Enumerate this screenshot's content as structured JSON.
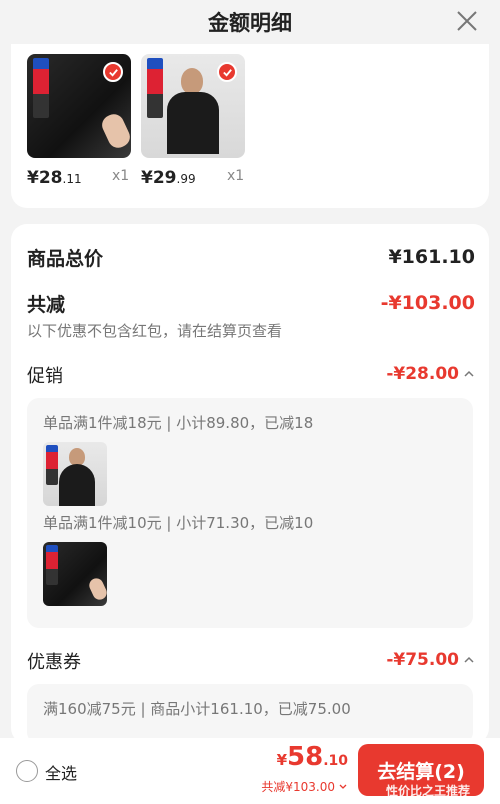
{
  "header": {
    "title": "金额明细"
  },
  "items": [
    {
      "price_main": "¥28",
      "price_dec": ".11",
      "qty": "x1"
    },
    {
      "price_main": "¥29",
      "price_dec": ".99",
      "qty": "x1"
    }
  ],
  "summary": {
    "total_label": "商品总价",
    "total_value": "¥161.10",
    "discount_label": "共减",
    "discount_value": "-¥103.00",
    "hint": "以下优惠不包含红包，请在结算页查看"
  },
  "promotion": {
    "label": "促销",
    "value": "-¥28.00",
    "rules": [
      {
        "text": "单品满1件减18元 | 小计89.80，已减18"
      },
      {
        "text": "单品满1件减10元 | 小计71.30，已减10"
      }
    ]
  },
  "coupon": {
    "label": "优惠券",
    "value": "-¥75.00",
    "rule_text": "满160减75元 | 商品小计161.10，已减75.00"
  },
  "footer": {
    "select_all": "全选",
    "currency": "¥",
    "amount": "58",
    "amount_dec": ".10",
    "saved": "共减¥103.00",
    "checkout": "去结算(2)",
    "watermark": "性价比之王推荐"
  },
  "colors": {
    "accent": "#e8392f",
    "background": "#f3f3f3"
  }
}
